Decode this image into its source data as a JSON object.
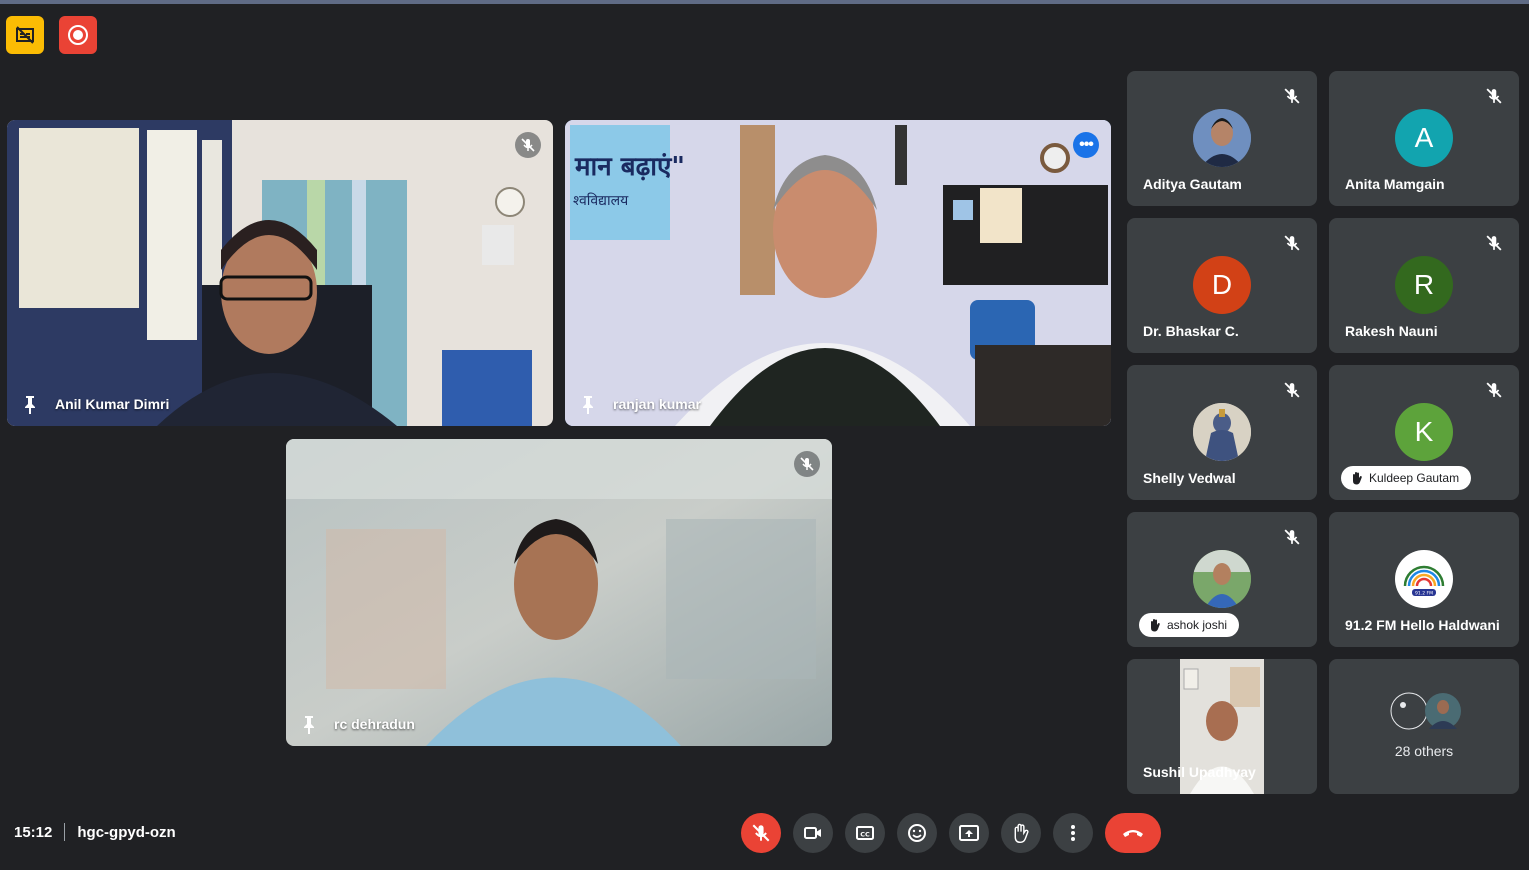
{
  "meeting": {
    "time": "15:12",
    "code": "hgc-gpyd-ozn"
  },
  "main_tiles": [
    {
      "name": "Anil Kumar Dimri"
    },
    {
      "name": "ranjan kumar"
    },
    {
      "name": "rc dehradun"
    }
  ],
  "side_tiles": [
    {
      "name": "Aditya Gautam",
      "type": "photo"
    },
    {
      "name": "Anita Mamgain",
      "initial": "A",
      "color": "#12a4af"
    },
    {
      "name": "Dr. Bhaskar C.",
      "initial": "D",
      "color": "#d24116"
    },
    {
      "name": "Rakesh Nauni",
      "initial": "R",
      "color": "#33691e"
    },
    {
      "name": "Shelly Vedwal",
      "type": "photo"
    },
    {
      "name": "Kuldeep Gautam",
      "initial": "K",
      "color": "#5da33b",
      "hand_raised": true
    },
    {
      "name": "ashok joshi",
      "type": "photo",
      "hand_raised": true
    },
    {
      "name": "91.2 FM Hello Haldwani",
      "type": "logo",
      "logo_text": "91.2 FM"
    },
    {
      "name": "Sushil Upadhyay",
      "type": "video"
    },
    {
      "name": "28 others"
    }
  ],
  "colors": {
    "background": "#202124",
    "tile": "#3c4043",
    "active_border": "#8ab4f8",
    "danger": "#ea4335",
    "caption_badge": "#fbbc04"
  },
  "controls": [
    "mic-off-icon",
    "camera-icon",
    "captions-icon",
    "emoji-icon",
    "present-icon",
    "raise-hand-icon",
    "more-options-icon",
    "end-call-icon"
  ]
}
